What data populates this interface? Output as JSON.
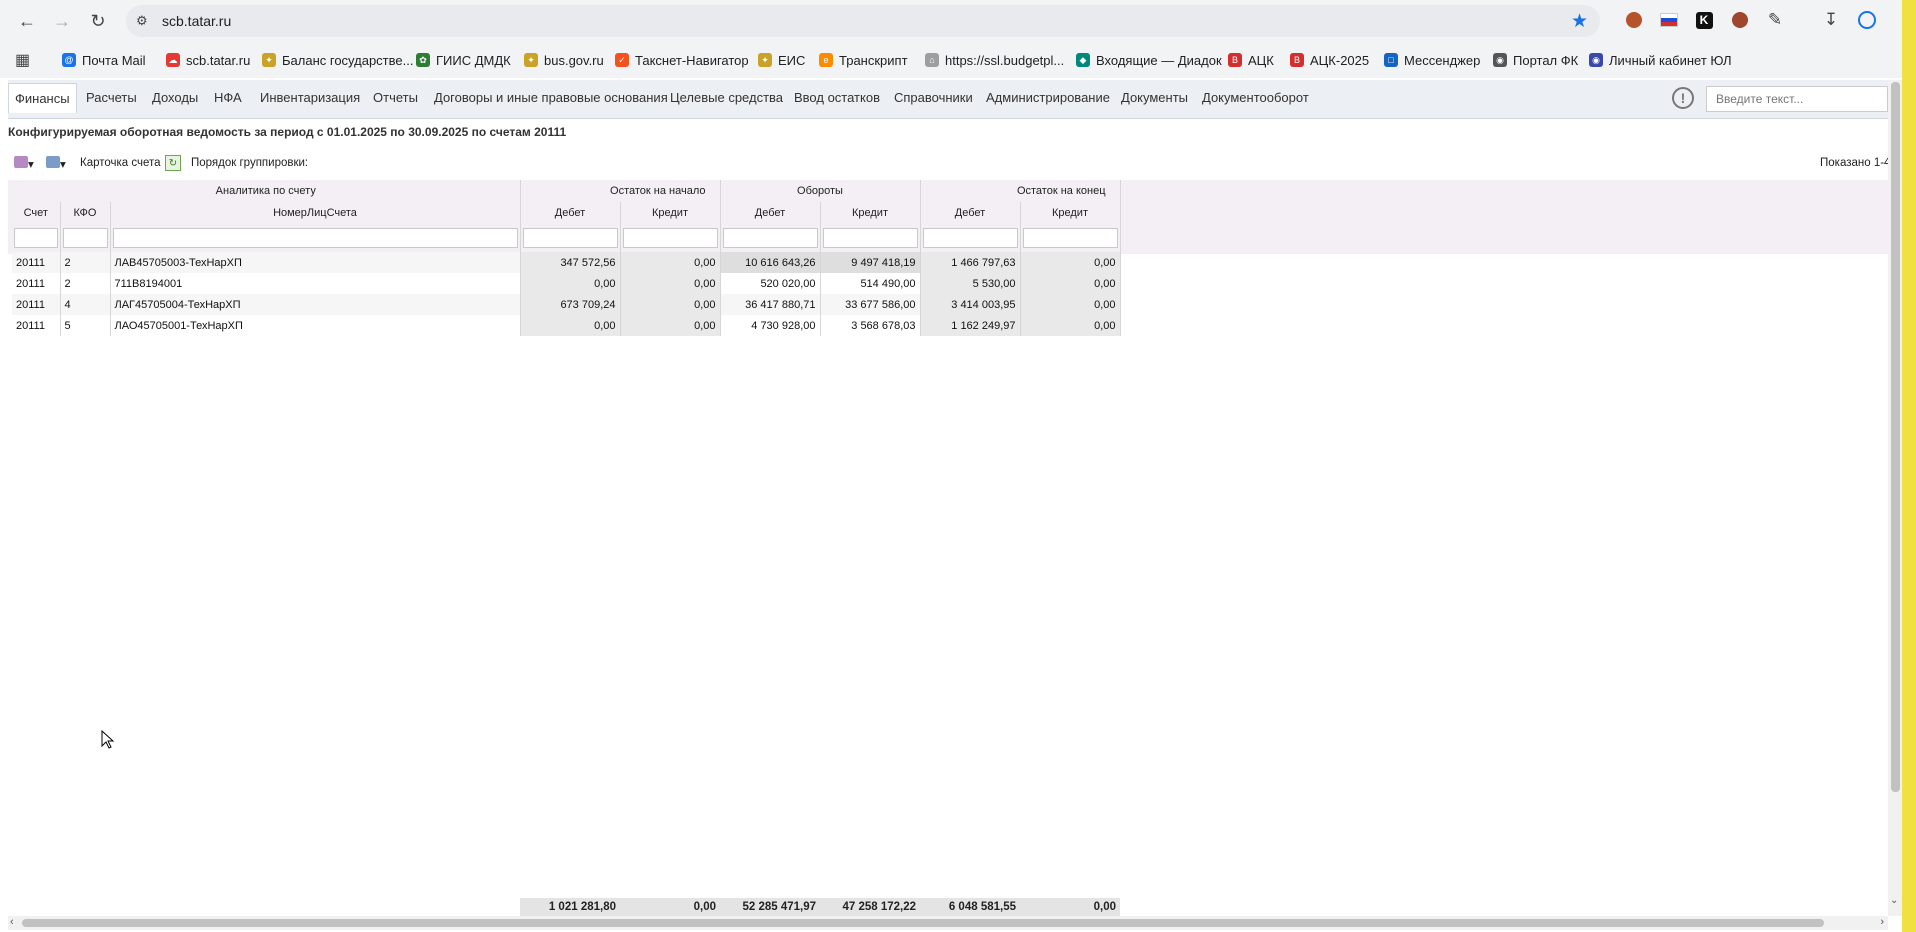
{
  "browser": {
    "url": "scb.tatar.ru",
    "bookmarks": [
      {
        "label": "Почта Mail",
        "icon": "mail-icon",
        "color": "#1a73e8"
      },
      {
        "label": "scb.tatar.ru",
        "icon": "cloud-icon",
        "color": "#e53935"
      },
      {
        "label": "Баланс государстве...",
        "icon": "emblem-icon",
        "color": "#c9a227"
      },
      {
        "label": "ГИИС ДМДК",
        "icon": "leaf-icon",
        "color": "#2e7d32"
      },
      {
        "label": "bus.gov.ru",
        "icon": "emblem-icon",
        "color": "#c9a227"
      },
      {
        "label": "Такснет-Навигатор",
        "icon": "check-icon",
        "color": "#f4511e"
      },
      {
        "label": "ЕИС",
        "icon": "emblem-icon",
        "color": "#c9a227"
      },
      {
        "label": "Транскрипт",
        "icon": "transcript-icon",
        "color": "#fb8c00"
      },
      {
        "label": "https://ssl.budgetpl...",
        "icon": "building-icon",
        "color": "#9e9e9e"
      },
      {
        "label": "Входящие — Диадок",
        "icon": "diadoc-icon",
        "color": "#00897b"
      },
      {
        "label": "АЦК",
        "icon": "bft-icon",
        "color": "#d32f2f"
      },
      {
        "label": "АЦК-2025",
        "icon": "bft-icon",
        "color": "#d32f2f"
      },
      {
        "label": "Мессенджер",
        "icon": "chat-icon",
        "color": "#1565c0"
      },
      {
        "label": "Портал ФК",
        "icon": "globe-icon",
        "color": "#555555"
      },
      {
        "label": "Личный кабинет ЮЛ",
        "icon": "cabinet-icon",
        "color": "#3949ab"
      }
    ]
  },
  "menu": {
    "items": [
      "Финансы",
      "Расчеты",
      "Доходы",
      "НФА",
      "Инвентаризация",
      "Отчеты",
      "Договоры и иные правовые основания",
      "Целевые средства",
      "Ввод остатков",
      "Справочники",
      "Администрирование",
      "Документы",
      "Документооборот"
    ],
    "active": "Финансы",
    "search_placeholder": "Введите текст..."
  },
  "report": {
    "title": "Конфигурируемая оборотная ведомость за период с 01.01.2025 по 30.09.2025 по счетам 20111",
    "toolbar": {
      "account_card": "Карточка счета",
      "grouping": "Порядок группировки:",
      "shown": "Показано 1-4"
    },
    "group_headers": {
      "analytics": "Аналитика по счету",
      "opening": "Остаток на начало",
      "turnover": "Обороты",
      "closing": "Остаток на конец"
    },
    "columns": [
      "Счет",
      "КФО",
      "НомерЛицСчета",
      "Дебет",
      "Кредит",
      "Дебет",
      "Кредит",
      "Дебет",
      "Кредит"
    ],
    "rows": [
      [
        "20111",
        "2",
        "ЛАВ45705003-ТехНарХП",
        "347 572,56",
        "0,00",
        "10 616 643,26",
        "9 497 418,19",
        "1 466 797,63",
        "0,00"
      ],
      [
        "20111",
        "2",
        "711В8194001",
        "0,00",
        "0,00",
        "520 020,00",
        "514 490,00",
        "5 530,00",
        "0,00"
      ],
      [
        "20111",
        "4",
        "ЛАГ45705004-ТехНарХП",
        "673 709,24",
        "0,00",
        "36 417 880,71",
        "33 677 586,00",
        "3 414 003,95",
        "0,00"
      ],
      [
        "20111",
        "5",
        "ЛАО45705001-ТехНарХП",
        "0,00",
        "0,00",
        "4 730 928,00",
        "3 568 678,03",
        "1 162 249,97",
        "0,00"
      ]
    ],
    "totals": [
      "1 021 281,80",
      "0,00",
      "52 285 471,97",
      "47 258 172,22",
      "6 048 581,55",
      "0,00"
    ]
  }
}
